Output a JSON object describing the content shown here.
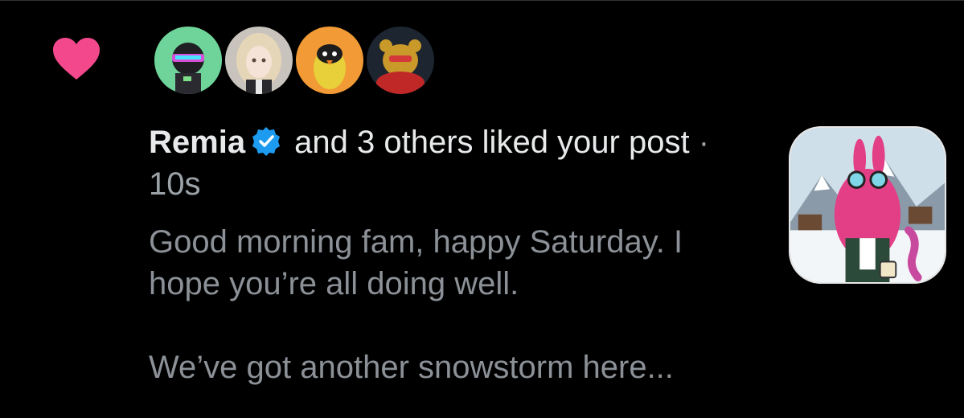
{
  "notification": {
    "type_icon": "heart-icon",
    "like_color": "#f3498c",
    "avatars": [
      {
        "name": "avatar-1",
        "bg": "#6fd49a"
      },
      {
        "name": "avatar-2",
        "bg": "#c9c3bd"
      },
      {
        "name": "avatar-3",
        "bg": "#f29a35"
      },
      {
        "name": "avatar-4",
        "bg": "#1d2530"
      }
    ],
    "username": "Remia",
    "verified_color": "#1d9bf0",
    "action_text": " and 3 others liked your post",
    "separator": " · ",
    "timestamp": "10s",
    "post_lines": [
      "Good morning fam, happy Saturday. I",
      "hope you’re all doing well.",
      "We’ve got another snowstorm here..."
    ]
  }
}
